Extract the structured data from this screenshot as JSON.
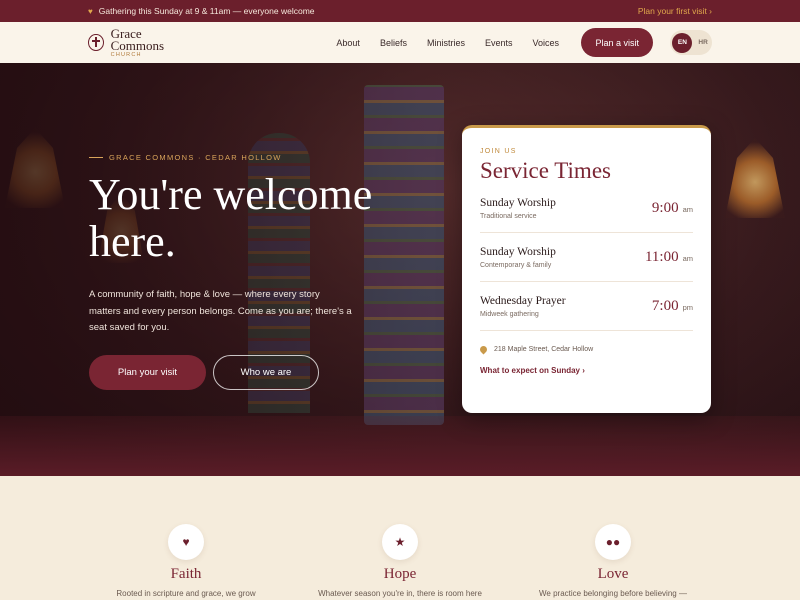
{
  "announcement": {
    "text": "Gathering this Sunday at 9 & 11am — everyone welcome",
    "link": "Plan your first visit ›"
  },
  "brand": {
    "name": "Grace Commons",
    "sub": "CHURCH"
  },
  "nav": {
    "links": [
      "About",
      "Beliefs",
      "Ministries",
      "Events",
      "Voices"
    ],
    "cta": "Plan a visit",
    "lang_active": "EN",
    "lang_other": "HR"
  },
  "hero": {
    "eyebrow": "GRACE COMMONS · CEDAR HOLLOW",
    "headline": "You're welcome here.",
    "intro": "A community of faith, hope & love — where every story matters and every person belongs. Come as you are; there's a seat saved for you.",
    "primary_button": "Plan your visit",
    "secondary_button": "Who we are"
  },
  "service_card": {
    "eyebrow": "JOIN US",
    "title": "Service Times",
    "services": [
      {
        "name": "Sunday Worship",
        "sub": "Traditional service",
        "time": "9:00",
        "ampm": "am"
      },
      {
        "name": "Sunday Worship",
        "sub": "Contemporary & family",
        "time": "11:00",
        "ampm": "am"
      },
      {
        "name": "Wednesday Prayer",
        "sub": "Midweek gathering",
        "time": "7:00",
        "ampm": "pm"
      }
    ],
    "address": "218 Maple Street, Cedar Hollow",
    "link": "What to expect on Sunday ›"
  },
  "values": [
    {
      "icon": "heart-icon",
      "title": "Faith",
      "desc": "Rooted in scripture and grace, we grow"
    },
    {
      "icon": "star-icon",
      "title": "Hope",
      "desc": "Whatever season you're in, there is room here"
    },
    {
      "icon": "people-icon",
      "title": "Love",
      "desc": "We practice belonging before believing —"
    }
  ],
  "colors": {
    "primary": "#7a2533",
    "accent": "#c99a4a",
    "cream": "#f5ecdc"
  }
}
